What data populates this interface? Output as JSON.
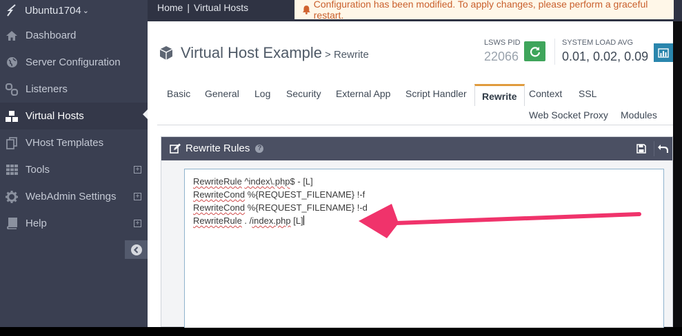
{
  "sidebar": {
    "brand": "Ubuntu1704",
    "items": [
      {
        "label": "Dashboard",
        "icon": "home-icon"
      },
      {
        "label": "Server Configuration",
        "icon": "globe-icon"
      },
      {
        "label": "Listeners",
        "icon": "link-icon"
      },
      {
        "label": "Virtual Hosts",
        "icon": "cubes-icon",
        "active": true
      },
      {
        "label": "VHost Templates",
        "icon": "copy-icon"
      },
      {
        "label": "Tools",
        "icon": "grid-icon",
        "expandable": true
      },
      {
        "label": "WebAdmin Settings",
        "icon": "gear-icon",
        "expandable": true
      },
      {
        "label": "Help",
        "icon": "book-icon",
        "expandable": true
      }
    ]
  },
  "breadcrumb": {
    "home": "Home",
    "sep": "|",
    "current": "Virtual Hosts"
  },
  "alert": {
    "text": "Configuration has been modified. To apply changes, please perform a graceful restart.",
    "color": "#c9602d"
  },
  "header": {
    "title": "Virtual Host Example",
    "subtitle": "> Rewrite",
    "pid_label": "LSWS PID",
    "pid_value": "22066",
    "load_label": "SYSTEM LOAD AVG",
    "load_value": "0.01, 0.02, 0.09"
  },
  "tabs": [
    "Basic",
    "General",
    "Log",
    "Security",
    "External App",
    "Script Handler",
    "Rewrite",
    "Context",
    "SSL",
    "Web Socket Proxy",
    "Modules"
  ],
  "active_tab": "Rewrite",
  "panel": {
    "title": "Rewrite Rules",
    "help": "?"
  },
  "editor": {
    "lines": [
      {
        "keyword": "RewriteRule",
        "rest_sq": "^index\\.php",
        "rest": "$ - [L]"
      },
      {
        "keyword": "RewriteCond",
        "rest": "%{REQUEST_FILENAME} !-f"
      },
      {
        "keyword": "RewriteCond",
        "rest": "%{REQUEST_FILENAME} !-d"
      },
      {
        "keyword": "RewriteRule",
        "rest_pre": " . /",
        "rest_sq": "index.php",
        "rest": " [L]"
      }
    ]
  },
  "colors": {
    "accent": "#e09b3d",
    "arrow": "#f0336b",
    "sidebar": "#3a3f51",
    "refresh": "#3fa55b",
    "chart": "#2a86ad"
  }
}
